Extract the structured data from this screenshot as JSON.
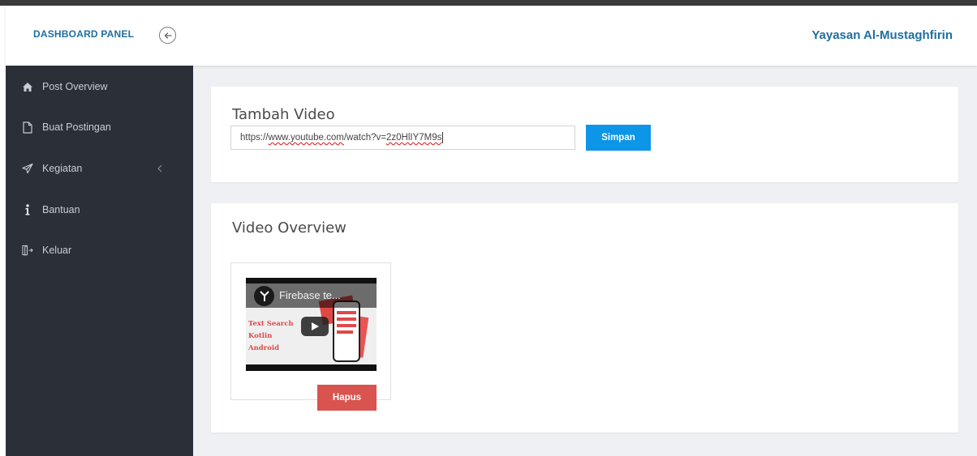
{
  "header": {
    "brand": "DASHBOARD PANEL",
    "org_name": "Yayasan Al-Mustaghfirin",
    "toggle_icon": "arrow-left-circle-icon"
  },
  "sidebar": {
    "items": [
      {
        "label": "Post Overview",
        "icon": "home-icon"
      },
      {
        "label": "Buat Postingan",
        "icon": "file-icon"
      },
      {
        "label": "Kegiatan",
        "icon": "paper-plane-icon",
        "has_submenu": true
      },
      {
        "label": "Bantuan",
        "icon": "info-icon"
      },
      {
        "label": "Keluar",
        "icon": "sign-out-icon"
      }
    ]
  },
  "add_video": {
    "title": "Tambah Video",
    "url_prefix": "https://",
    "url_host": "www.youtube.com",
    "url_path": "/watch?v=",
    "url_id": "2z0HlIY7M9s",
    "save_label": "Simpan"
  },
  "video_overview": {
    "title": "Video Overview",
    "videos": [
      {
        "thumbnail_title": "Firebase te...",
        "thumbnail_lines": [
          "Text Search",
          "Kotlin",
          "Android"
        ],
        "delete_label": "Hapus"
      }
    ]
  },
  "colors": {
    "sidebar_bg": "#2b3038",
    "brand": "#1f6f9f",
    "save_button": "#0d95e8",
    "delete_button": "#d9534f"
  }
}
